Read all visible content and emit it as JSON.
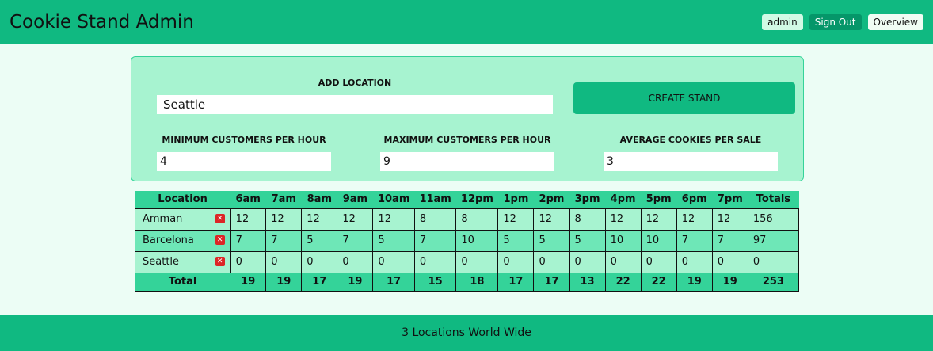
{
  "header": {
    "title": "Cookie Stand Admin",
    "user_label": "admin",
    "signout_label": "Sign Out",
    "overview_label": "Overview"
  },
  "form": {
    "add_location_label": "ADD LOCATION",
    "location_value": "Seattle",
    "create_button_label": "CREATE STAND",
    "min_label": "MINIMUM CUSTOMERS PER HOUR",
    "min_value": "4",
    "max_label": "MAXIMUM CUSTOMERS PER HOUR",
    "max_value": "9",
    "avg_label": "AVERAGE COOKIES PER SALE",
    "avg_value": "3"
  },
  "table": {
    "headers": [
      "Location",
      "6am",
      "7am",
      "8am",
      "9am",
      "10am",
      "11am",
      "12pm",
      "1pm",
      "2pm",
      "3pm",
      "4pm",
      "5pm",
      "6pm",
      "7pm",
      "Totals"
    ],
    "rows": [
      {
        "location": "Amman",
        "values": [
          "12",
          "12",
          "12",
          "12",
          "12",
          "8",
          "8",
          "12",
          "12",
          "8",
          "12",
          "12",
          "12",
          "12",
          "156"
        ]
      },
      {
        "location": "Barcelona",
        "values": [
          "7",
          "7",
          "5",
          "7",
          "5",
          "7",
          "10",
          "5",
          "5",
          "5",
          "10",
          "10",
          "7",
          "7",
          "97"
        ]
      },
      {
        "location": "Seattle",
        "values": [
          "0",
          "0",
          "0",
          "0",
          "0",
          "0",
          "0",
          "0",
          "0",
          "0",
          "0",
          "0",
          "0",
          "0",
          "0"
        ]
      }
    ],
    "delete_icon": "close-icon",
    "delete_glyph": "✕",
    "footer_label": "Total",
    "footer_values": [
      "19",
      "19",
      "17",
      "19",
      "17",
      "15",
      "18",
      "17",
      "17",
      "13",
      "22",
      "22",
      "19",
      "19",
      "253"
    ]
  },
  "footer": {
    "text": "3 Locations World Wide"
  },
  "colors": {
    "primary": "#10b981",
    "form_bg": "#a7f3d0",
    "row_alt": "#6ee7b7",
    "delete": "#dc2626"
  }
}
